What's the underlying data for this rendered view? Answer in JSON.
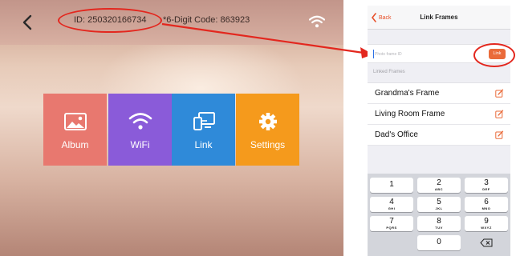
{
  "frame_screen": {
    "frame_id_text": "ID: 250320166734",
    "code_text": "*6-Digit Code: 863923",
    "back_icon": "chevron-left-icon",
    "wifi_icon": "wifi-icon",
    "tiles": [
      {
        "label": "Album",
        "icon": "photo-icon",
        "color": "#e8786f"
      },
      {
        "label": "WiFi",
        "icon": "wifi-icon",
        "color": "#8a5bd9"
      },
      {
        "label": "Link",
        "icon": "link-devices-icon",
        "color": "#2f8ad9"
      },
      {
        "label": "Settings",
        "icon": "gear-icon",
        "color": "#f59a1c"
      }
    ]
  },
  "phone": {
    "nav": {
      "back_label": "Back",
      "title": "Link Frames"
    },
    "input": {
      "placeholder": "Photo frame ID",
      "value": ""
    },
    "link_button_label": "Link",
    "section_label": "Linked Frames",
    "linked_frames": [
      "Grandma's Frame",
      "Living Room Frame",
      "Dad's Office"
    ],
    "keypad": [
      {
        "digit": "1",
        "letters": ""
      },
      {
        "digit": "2",
        "letters": "ABC"
      },
      {
        "digit": "3",
        "letters": "DEF"
      },
      {
        "digit": "4",
        "letters": "GHI"
      },
      {
        "digit": "5",
        "letters": "JKL"
      },
      {
        "digit": "6",
        "letters": "MNO"
      },
      {
        "digit": "7",
        "letters": "PQRS"
      },
      {
        "digit": "8",
        "letters": "TUV"
      },
      {
        "digit": "9",
        "letters": "WXYZ"
      },
      {
        "digit": "0",
        "letters": ""
      }
    ],
    "delete_icon": "backspace-icon"
  },
  "colors": {
    "annotation_red": "#e3271e",
    "accent_orange": "#ea6b3a"
  }
}
